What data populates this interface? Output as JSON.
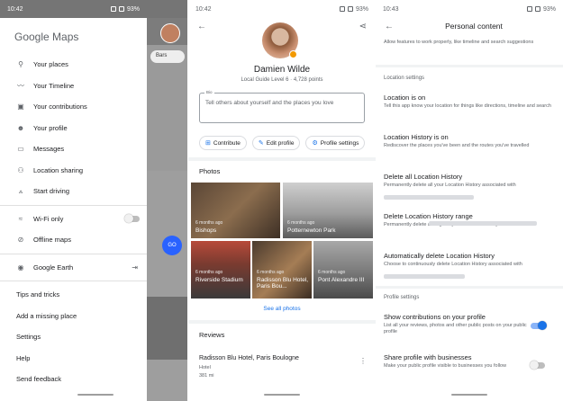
{
  "panel1": {
    "status_time": "10:42",
    "status_battery": "93%",
    "logo": "Google Maps",
    "map_chip": "Bars",
    "map_go": "GO",
    "menu": [
      {
        "icon": "pin-icon",
        "glyph": "⚲",
        "label": "Your places"
      },
      {
        "icon": "timeline-icon",
        "glyph": "〰",
        "label": "Your Timeline"
      },
      {
        "icon": "contributions-icon",
        "glyph": "▣",
        "label": "Your contributions"
      },
      {
        "icon": "profile-icon",
        "glyph": "☻",
        "label": "Your profile"
      },
      {
        "icon": "messages-icon",
        "glyph": "▭",
        "label": "Messages"
      },
      {
        "icon": "location-sharing-icon",
        "glyph": "⚇",
        "label": "Location sharing"
      },
      {
        "icon": "driving-icon",
        "glyph": "⟑",
        "label": "Start driving"
      }
    ],
    "wifi_label": "Wi-Fi only",
    "offline_label": "Offline maps",
    "earth_label": "Google Earth",
    "tail": [
      "Tips and tricks",
      "Add a missing place",
      "Settings",
      "Help",
      "Send feedback"
    ]
  },
  "panel2": {
    "status_time": "10:42",
    "status_battery": "93%",
    "name": "Damien Wilde",
    "guide": "Local Guide Level 6 · 4,728 points",
    "bio_label": "Bio",
    "bio_placeholder": "Tell others about yourself and the places you love",
    "chips": [
      "Contribute",
      "Edit profile",
      "Profile settings"
    ],
    "photos_header": "Photos",
    "photos": [
      {
        "date": "6 months ago",
        "name": "Bishops"
      },
      {
        "date": "6 months ago",
        "name": "Potternewton Park"
      },
      {
        "date": "6 months ago",
        "name": "Riverside Stadium"
      },
      {
        "date": "6 months ago",
        "name": "Radisson Blu Hotel, Paris Bou..."
      },
      {
        "date": "6 months ago",
        "name": "Pont Alexandre III"
      }
    ],
    "see_all": "See all photos",
    "reviews_header": "Reviews",
    "review_title": "Radisson Blu Hotel, Paris Boulogne",
    "review_type": "Hotel",
    "review_dist": "381 mi"
  },
  "panel3": {
    "status_time": "10:43",
    "status_battery": "93%",
    "title": "Personal content",
    "top_text": "Allow features to work properly, like timeline and search suggestions",
    "location_settings": "Location settings",
    "rows": [
      {
        "title": "Location is on",
        "desc": "Tell this app know your location for things like directions, timeline and search"
      },
      {
        "title": "Location History is on",
        "desc": "Rediscover the places you've been and the routes you've travelled"
      },
      {
        "title": "Delete all Location History",
        "desc": "Permanently delete all your Location History associated with"
      },
      {
        "title": "Delete Location History range",
        "desc": "Permanently delete a range of your Location History associated with"
      },
      {
        "title": "Automatically delete Location History",
        "desc": "Choose to continuously delete Location History associated with"
      }
    ],
    "profile_settings": "Profile settings",
    "show_contrib_title": "Show contributions on your profile",
    "show_contrib_desc": "List all your reviews, photos and other public posts on your public profile",
    "share_title": "Share profile with businesses",
    "share_desc": "Make your public profile visible to businesses you follow"
  },
  "colors": {
    "accent": "#1a73e8",
    "badge": "#f29900"
  }
}
